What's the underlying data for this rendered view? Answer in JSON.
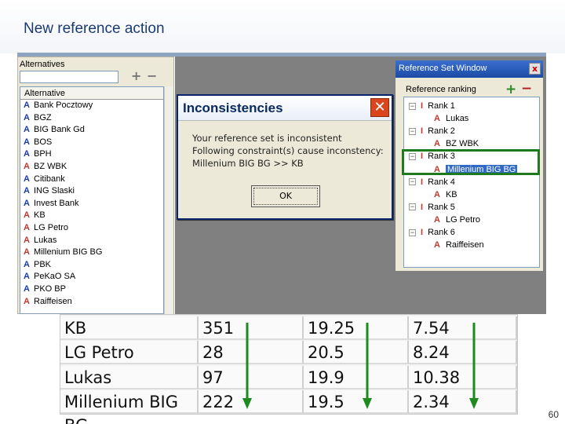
{
  "slide": {
    "title": "New reference action",
    "page_number": "60"
  },
  "alternatives": {
    "heading": "Alternatives",
    "add_label": "+",
    "remove_label": "−",
    "column_header": "Alternative",
    "items": [
      {
        "marker": "A",
        "label": "Bank Pocztowy",
        "color": "#1a3ca8"
      },
      {
        "marker": "A",
        "label": "BGZ",
        "color": "#1a3ca8"
      },
      {
        "marker": "A",
        "label": "BIG Bank Gd",
        "color": "#1a3ca8"
      },
      {
        "marker": "A",
        "label": "BOS",
        "color": "#1a3ca8"
      },
      {
        "marker": "A",
        "label": "BPH",
        "color": "#1a3ca8"
      },
      {
        "marker": "A",
        "label": "BZ WBK",
        "color": "#c0392b"
      },
      {
        "marker": "A",
        "label": "Citibank",
        "color": "#1a3ca8"
      },
      {
        "marker": "A",
        "label": "ING Slaski",
        "color": "#1a3ca8"
      },
      {
        "marker": "A",
        "label": "Invest Bank",
        "color": "#1a3ca8"
      },
      {
        "marker": "A",
        "label": "KB",
        "color": "#c0392b"
      },
      {
        "marker": "A",
        "label": "LG Petro",
        "color": "#c0392b"
      },
      {
        "marker": "A",
        "label": "Lukas",
        "color": "#c0392b"
      },
      {
        "marker": "A",
        "label": "Millenium BIG BG",
        "color": "#c0392b"
      },
      {
        "marker": "A",
        "label": "PBK",
        "color": "#1a3ca8"
      },
      {
        "marker": "A",
        "label": "PeKaO SA",
        "color": "#1a3ca8"
      },
      {
        "marker": "A",
        "label": "PKO BP",
        "color": "#1a3ca8"
      },
      {
        "marker": "A",
        "label": "Raiffeisen",
        "color": "#c0392b"
      }
    ]
  },
  "dialog": {
    "title": "Inconsistencies",
    "close_label": "✕",
    "lines": [
      "Your reference set is inconsistent",
      "Following constraint(s) cause inconstency:",
      "Millenium BIG BG >> KB"
    ],
    "ok_label": "OK"
  },
  "reference_window": {
    "title": "Reference Set Window",
    "close_label": "x",
    "heading": "Reference ranking",
    "add_label": "+",
    "remove_label": "−",
    "tree": [
      {
        "kind": "rank",
        "toggle": "−",
        "marker": "I",
        "label": "Rank 1"
      },
      {
        "kind": "alt",
        "marker": "A",
        "label": "Lukas",
        "selected": false
      },
      {
        "kind": "rank",
        "toggle": "−",
        "marker": "I",
        "label": "Rank 2"
      },
      {
        "kind": "alt",
        "marker": "A",
        "label": "BZ WBK",
        "selected": false
      },
      {
        "kind": "rank",
        "toggle": "−",
        "marker": "I",
        "label": "Rank 3"
      },
      {
        "kind": "alt",
        "marker": "A",
        "label": "Millenium BIG BG",
        "selected": true
      },
      {
        "kind": "rank",
        "toggle": "−",
        "marker": "I",
        "label": "Rank 4"
      },
      {
        "kind": "alt",
        "marker": "A",
        "label": "KB",
        "selected": false
      },
      {
        "kind": "rank",
        "toggle": "−",
        "marker": "I",
        "label": "Rank 5"
      },
      {
        "kind": "alt",
        "marker": "A",
        "label": "LG Petro",
        "selected": false
      },
      {
        "kind": "rank",
        "toggle": "−",
        "marker": "I",
        "label": "Rank 6"
      },
      {
        "kind": "alt",
        "marker": "A",
        "label": "Raiffeisen",
        "selected": false
      }
    ]
  },
  "data_table": {
    "rows": [
      [
        "KB",
        "351",
        "19.25",
        "7.54"
      ],
      [
        "LG Petro",
        "28",
        "20.5",
        "8.24"
      ],
      [
        "Lukas",
        "97",
        "19.9",
        "10.38"
      ],
      [
        "Millenium BIG BG",
        "222",
        "19.5",
        "2.34"
      ]
    ],
    "arrow_color": "#1f8a1f"
  }
}
